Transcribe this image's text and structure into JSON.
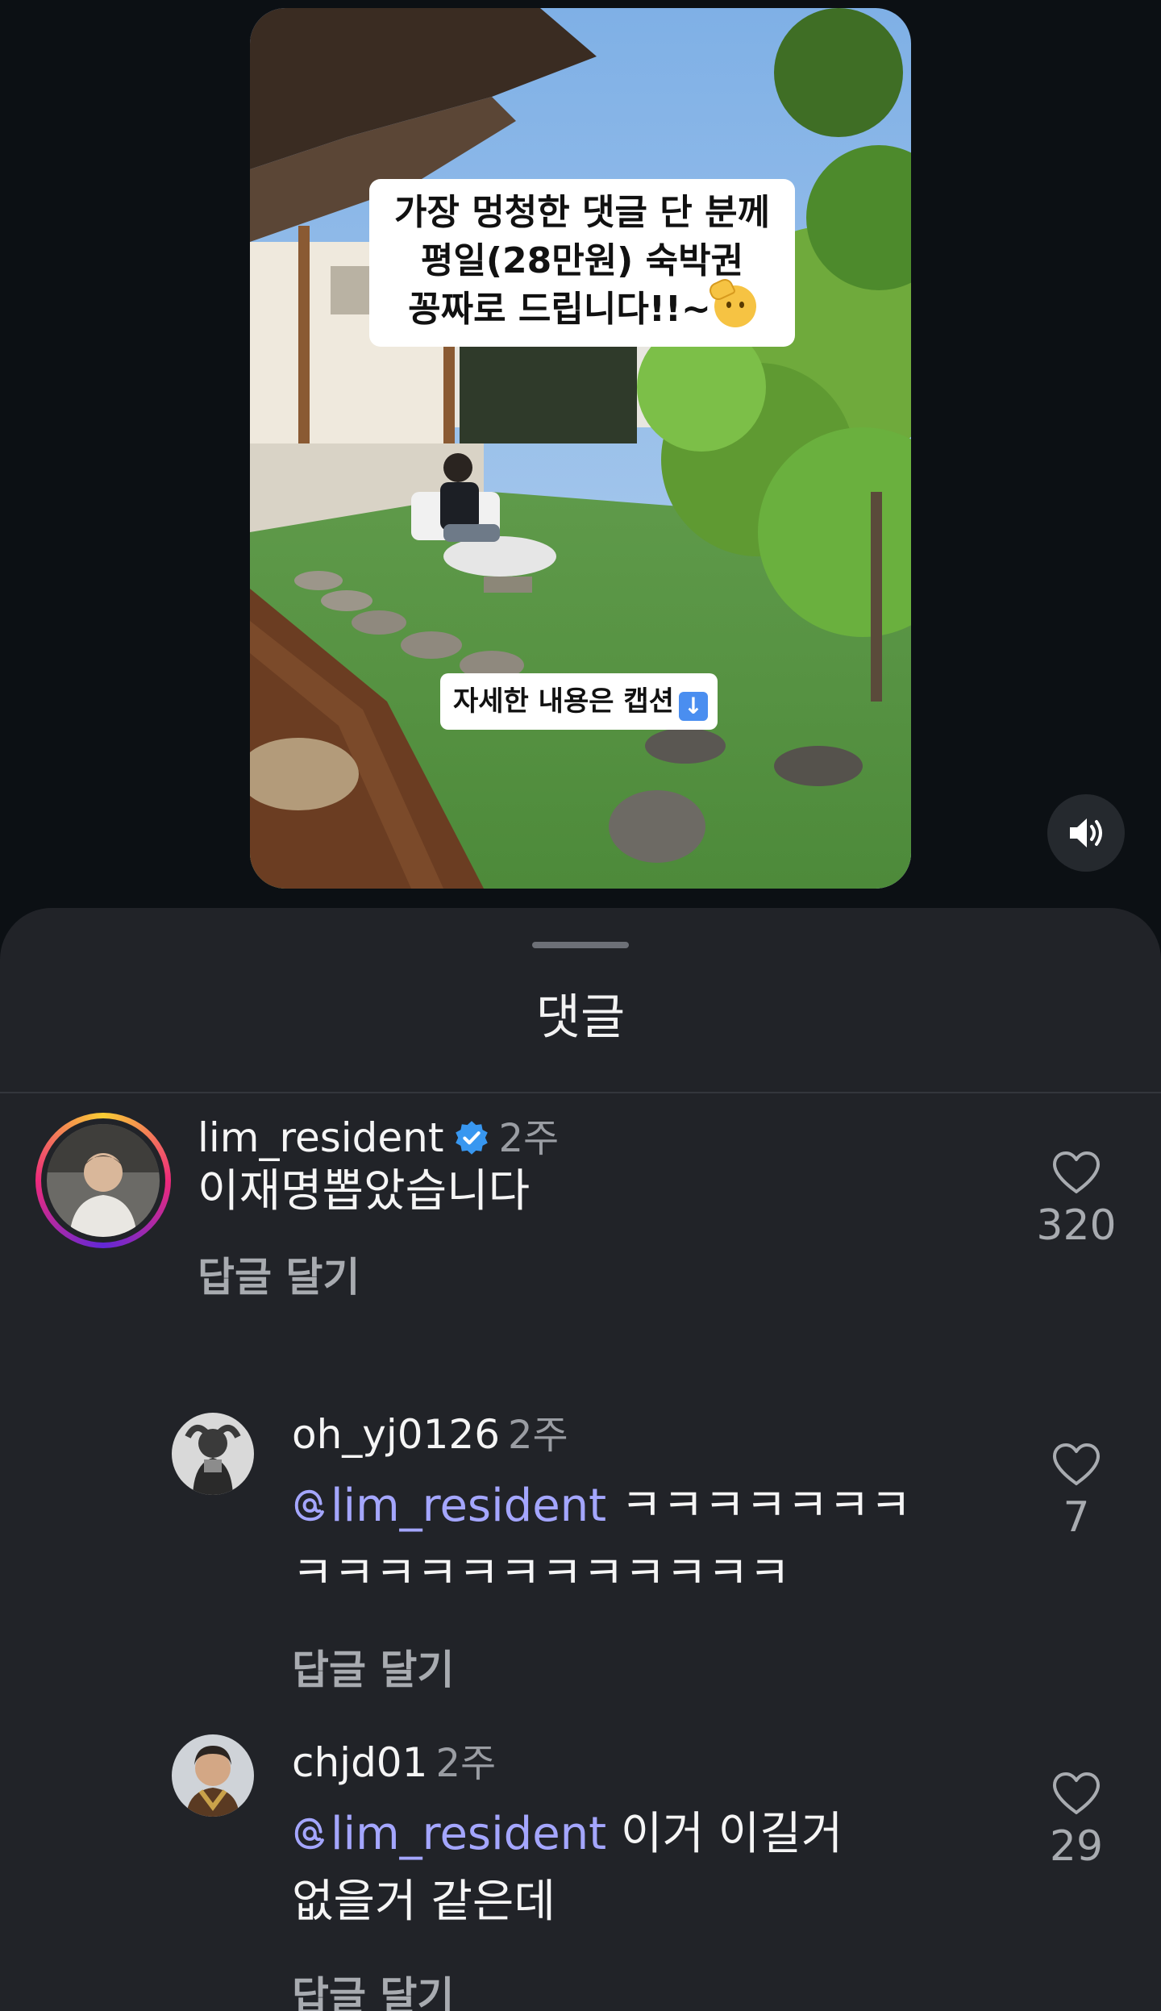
{
  "video": {
    "caption_lines": [
      "가장 멍청한 댓글 단 분께",
      "평일(28만원) 숙박권",
      "꽁짜로 드립니다!!~"
    ],
    "emoji": "saluting-face-emoji",
    "sub_caption": "자세한 내용은 캡션",
    "sub_caption_icon": "arrow-down-icon",
    "speaker_icon": "speaker-icon"
  },
  "sheet": {
    "title": "댓글"
  },
  "comments": [
    {
      "username": "lim_resident",
      "verified": true,
      "time": "2주",
      "text": "이재명뽑았습니다",
      "reply_label": "답글 달기",
      "likes": "320"
    },
    {
      "username": "oh_yj0126",
      "time": "2주",
      "mention": "lim_resident",
      "text_line1": "ㅋㅋㅋㅋㅋㅋㅋ",
      "text_line2": "ㅋㅋㅋㅋㅋㅋㅋㅋㅋㅋㅋㅋ",
      "reply_label": "답글 달기",
      "likes": "7"
    },
    {
      "username": "chjd01",
      "time": "2주",
      "mention": "lim_resident",
      "text_line1": "이거 이길거",
      "text_line2": "없을거 같은데",
      "reply_label": "답글 달기",
      "likes": "29"
    }
  ],
  "colors": {
    "background": "#0c1014",
    "sheet": "#212328",
    "mention": "#a4a6ff",
    "verified": "#3897f0"
  }
}
